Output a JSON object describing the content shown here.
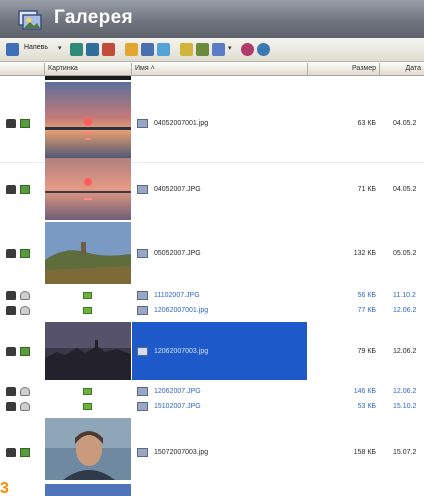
{
  "window": {
    "title": "Галерея",
    "app_icon": "gallery-app-icon"
  },
  "toolbar": {
    "sort_label": "Напевь",
    "items": [
      "sort-icon",
      "grid-icon",
      "view-icon",
      "list-icon",
      "folder-icon",
      "save-icon",
      "refresh-icon",
      "up-icon",
      "export-icon",
      "columns-icon",
      "help-icon",
      "settings-icon"
    ]
  },
  "columns": {
    "thumb": "Картинка",
    "name": "Имя ˄",
    "size": "Размер",
    "date": "Дата"
  },
  "rows": [
    {
      "name": "04052007001.jpg",
      "size": "63 КБ",
      "date": "04.05.2"
    },
    {
      "name": "04052007.JPG",
      "size": "71 КБ",
      "date": "04.05.2"
    },
    {
      "name": "05052007.JPG",
      "size": "132 КБ",
      "date": "05.05.2"
    },
    {
      "name": "11102007.JPG",
      "size": "56 КБ",
      "date": "11.10.2"
    },
    {
      "name": "12062007001.jpg",
      "size": "77 КБ",
      "date": "12.06.2"
    },
    {
      "name": "12062007003.jpg",
      "size": "79 КБ",
      "date": "12.06.2"
    },
    {
      "name": "12062007.JPG",
      "size": "146 КБ",
      "date": "12.06.2"
    },
    {
      "name": "15102007.JPG",
      "size": "53 КБ",
      "date": "15.10.2"
    },
    {
      "name": "15072007003.jpg",
      "size": "158 КБ",
      "date": "15.07.2"
    }
  ],
  "corner_badge": "3",
  "colors": {
    "selection": "#1d59c8",
    "link_text": "#2f65c9",
    "titlebar": "#6f747e",
    "badge": "#ff8a00"
  }
}
